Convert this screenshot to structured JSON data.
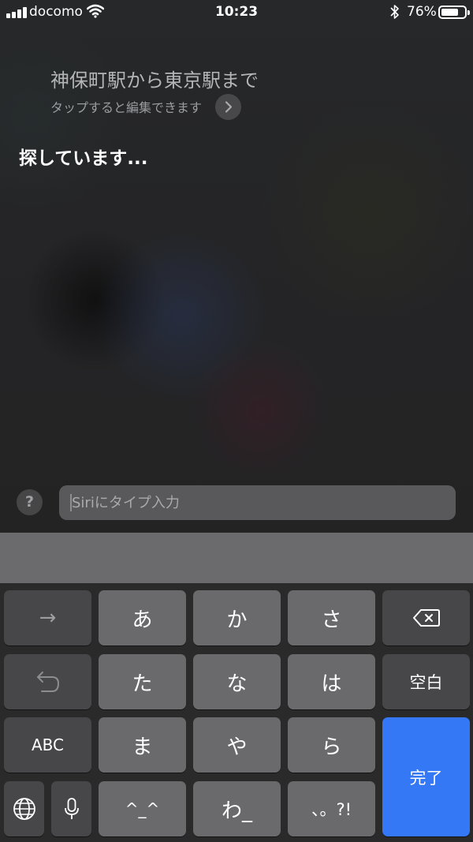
{
  "status_bar": {
    "carrier": "docomo",
    "time": "10:23",
    "battery_percent": "76%",
    "battery_level": 0.76
  },
  "siri": {
    "query": "神保町駅から東京駅まで",
    "edit_hint": "タップすると編集できます",
    "status": "探しています...",
    "help_label": "?",
    "type_placeholder": "Siriにタイプ入力"
  },
  "keyboard": {
    "next_arrow": "→",
    "a": "あ",
    "ka": "か",
    "sa": "さ",
    "ta": "た",
    "na": "な",
    "ha": "は",
    "space": "空白",
    "abc": "ABC",
    "ma": "ま",
    "ya": "や",
    "ra": "ら",
    "done": "完了",
    "emoticon": "^_^",
    "wa": "わ_",
    "punct": "、。?!"
  },
  "icons": [
    "signal-icon",
    "wifi-icon",
    "bluetooth-icon",
    "battery-icon",
    "chevron-right-icon",
    "delete-icon",
    "undo-icon",
    "globe-icon",
    "microphone-icon"
  ]
}
